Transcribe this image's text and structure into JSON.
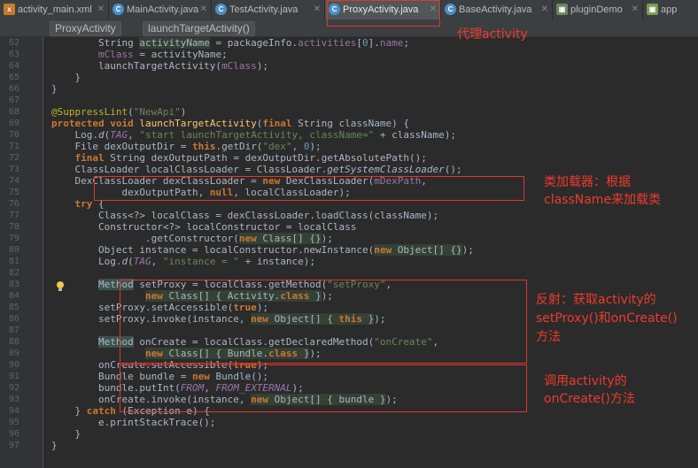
{
  "tabs": [
    {
      "label": "activity_main.xml",
      "icon": "xml-file-icon"
    },
    {
      "label": "MainActivity.java",
      "icon": "java-class-icon"
    },
    {
      "label": "TestActivity.java",
      "icon": "java-class-icon"
    },
    {
      "label": "ProxyActivity.java",
      "icon": "java-class-icon"
    },
    {
      "label": "BaseActivity.java",
      "icon": "java-class-icon"
    },
    {
      "label": "pluginDemo",
      "icon": "module-icon"
    },
    {
      "label": "app",
      "icon": "app-module-icon"
    }
  ],
  "breadcrumb": {
    "class": "ProxyActivity",
    "method": "launchTargetActivity()"
  },
  "line_numbers": [
    "62",
    "63",
    "64",
    "65",
    "66",
    "67",
    "68",
    "69",
    "70",
    "71",
    "72",
    "73",
    "74",
    "75",
    "76",
    "77",
    "78",
    "79",
    "80",
    "81",
    "82",
    "83",
    "84",
    "85",
    "86",
    "87",
    "88",
    "89",
    "90",
    "91",
    "92",
    "93",
    "94",
    "95",
    "96",
    "97"
  ],
  "annotations": {
    "tab_note": "代理activity",
    "note1_line1": "类加载器：根据",
    "note1_line2": "className来加载类",
    "note2_line1": "反射：获取activity的",
    "note2_line2": "setProxy()和onCreate()",
    "note2_line3": "方法",
    "note3_line1": "调用activity的",
    "note3_line2": "onCreate()方法"
  },
  "colors": {
    "annotation": "#e2352d",
    "background": "#2b2b2b",
    "keyword": "#cc7832",
    "string": "#6a8759",
    "field": "#9876aa"
  }
}
